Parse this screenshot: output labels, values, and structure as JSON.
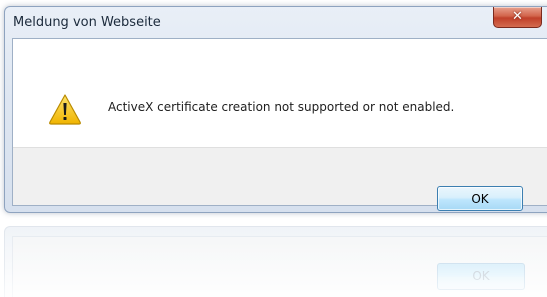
{
  "window": {
    "title": "Meldung von Webseite",
    "close_glyph": "✕"
  },
  "message": {
    "icon": "warning-icon",
    "text": "ActiveX certificate creation not supported or not enabled."
  },
  "buttons": {
    "ok_label": "OK"
  },
  "reflection": {
    "ok_label": "OK"
  },
  "colors": {
    "close_button": "#c8452e",
    "ok_button_border": "#3c7fb1",
    "warning_yellow": "#f5c400"
  }
}
